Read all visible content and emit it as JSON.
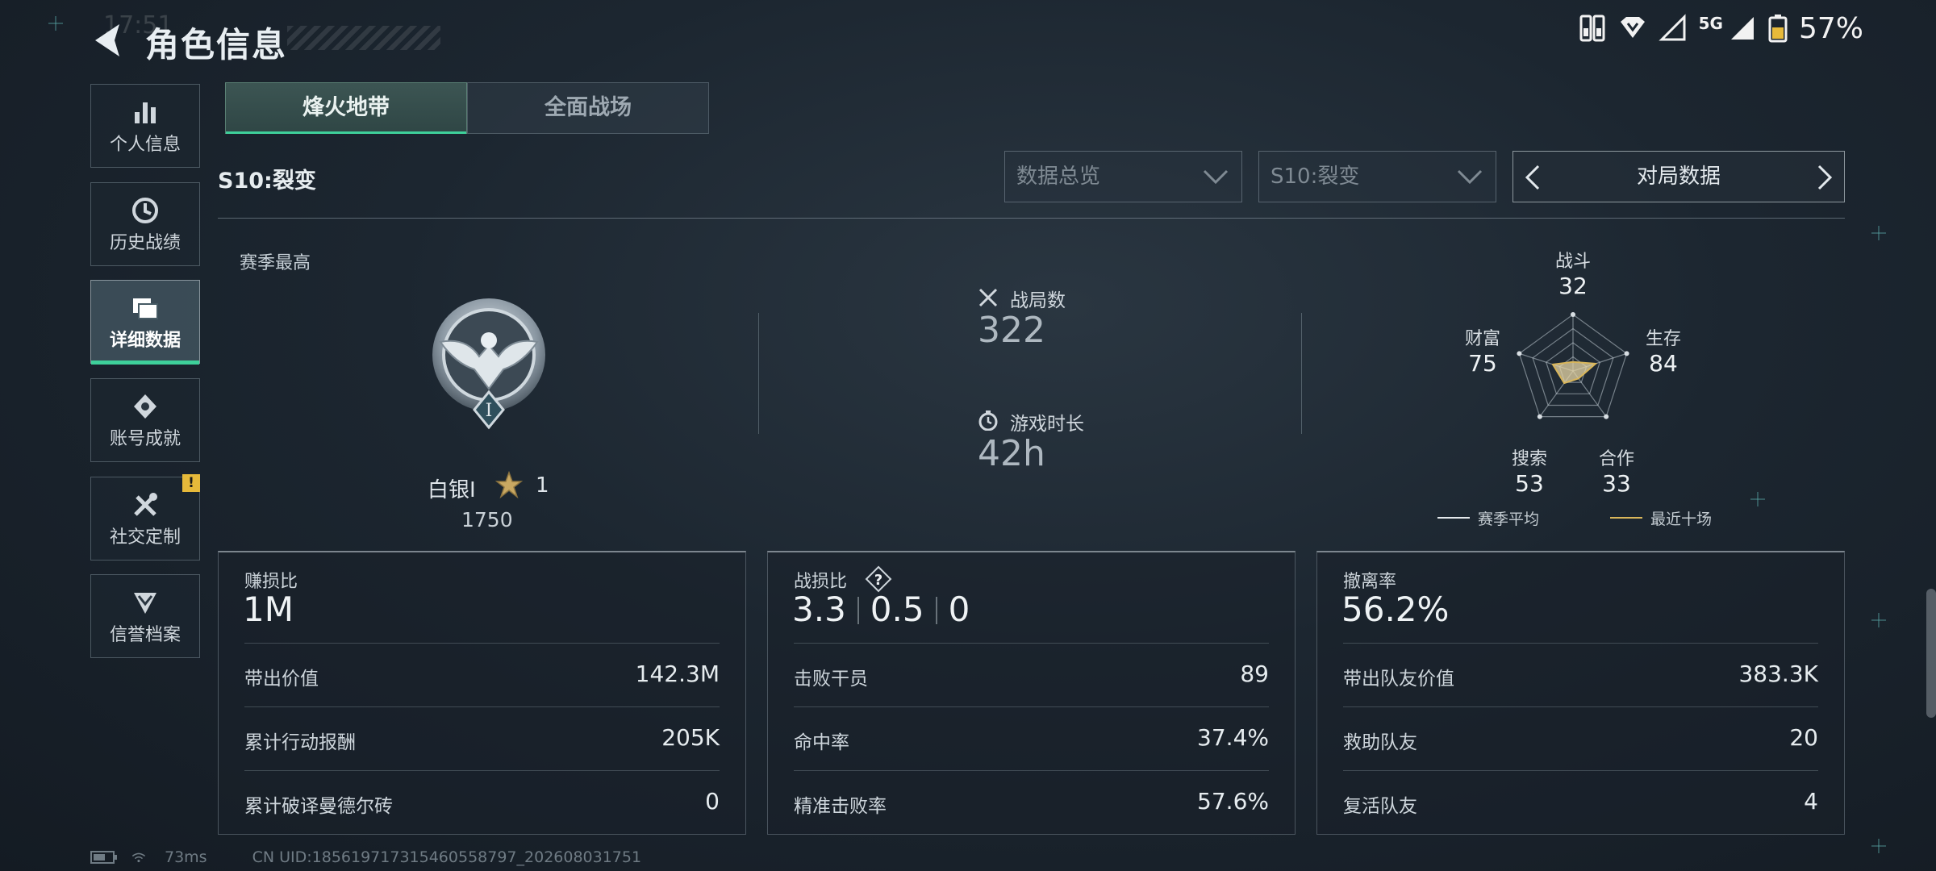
{
  "header": {
    "title": "角色信息",
    "clock": "17:51"
  },
  "status_bar": {
    "network": "5G",
    "battery": "57%"
  },
  "sidebar": {
    "items": [
      {
        "label": "个人信息",
        "icon": "bar-chart-icon"
      },
      {
        "label": "历史战绩",
        "icon": "history-clock-icon"
      },
      {
        "label": "详细数据",
        "icon": "folder-icon",
        "active": true
      },
      {
        "label": "账号成就",
        "icon": "achievement-badge-icon"
      },
      {
        "label": "社交定制",
        "icon": "tools-icon",
        "badge": "!"
      },
      {
        "label": "信誉档案",
        "icon": "shield-chevron-icon"
      }
    ]
  },
  "mode_tabs": [
    {
      "label": "烽火地带",
      "active": true
    },
    {
      "label": "全面战场",
      "active": false
    }
  ],
  "season_label": "S10:裂变",
  "filters": {
    "overview": "数据总览",
    "season": "S10:裂变",
    "match_data": "对局数据"
  },
  "summary": {
    "season_best_label": "赛季最高",
    "rank_name": "白银I",
    "rank_stars": "1",
    "rank_score": "1750",
    "rank_numeral": "I",
    "matches_label": "战局数",
    "matches_value": "322",
    "time_label": "游戏时长",
    "time_value": "42h"
  },
  "radar": {
    "axes": [
      {
        "label": "战斗",
        "value": "32",
        "n": 32
      },
      {
        "label": "生存",
        "value": "84",
        "n": 84
      },
      {
        "label": "合作",
        "value": "33",
        "n": 33
      },
      {
        "label": "搜索",
        "value": "53",
        "n": 53
      },
      {
        "label": "财富",
        "value": "75",
        "n": 75
      }
    ],
    "legend": {
      "season_avg": "赛季平均",
      "recent_ten": "最近十场"
    },
    "colors": {
      "recent": "#d9b65a",
      "fill": "#e7d6a6"
    }
  },
  "panels": {
    "profit": {
      "title": "赚损比",
      "big": "1M",
      "rows": [
        {
          "k": "带出价值",
          "v": "142.3M"
        },
        {
          "k": "累计行动报酬",
          "v": "205K"
        },
        {
          "k": "累计破译曼德尔砖",
          "v": "0"
        }
      ]
    },
    "kd": {
      "title": "战损比",
      "help": "?",
      "big_a": "3.3",
      "big_b": "0.5",
      "big_c": "0",
      "rows": [
        {
          "k": "击败干员",
          "v": "89"
        },
        {
          "k": "命中率",
          "v": "37.4%"
        },
        {
          "k": "精准击败率",
          "v": "57.6%"
        }
      ]
    },
    "extract": {
      "title": "撤离率",
      "big": "56.2%",
      "rows": [
        {
          "k": "带出队友价值",
          "v": "383.3K"
        },
        {
          "k": "救助队友",
          "v": "20"
        },
        {
          "k": "复活队友",
          "v": "4"
        }
      ]
    }
  },
  "footer": {
    "ping": "73ms",
    "uid": "CN UID:185619717315460558797_202608031751"
  },
  "colors": {
    "accent": "#3ed09a",
    "warning": "#e6b93a"
  }
}
